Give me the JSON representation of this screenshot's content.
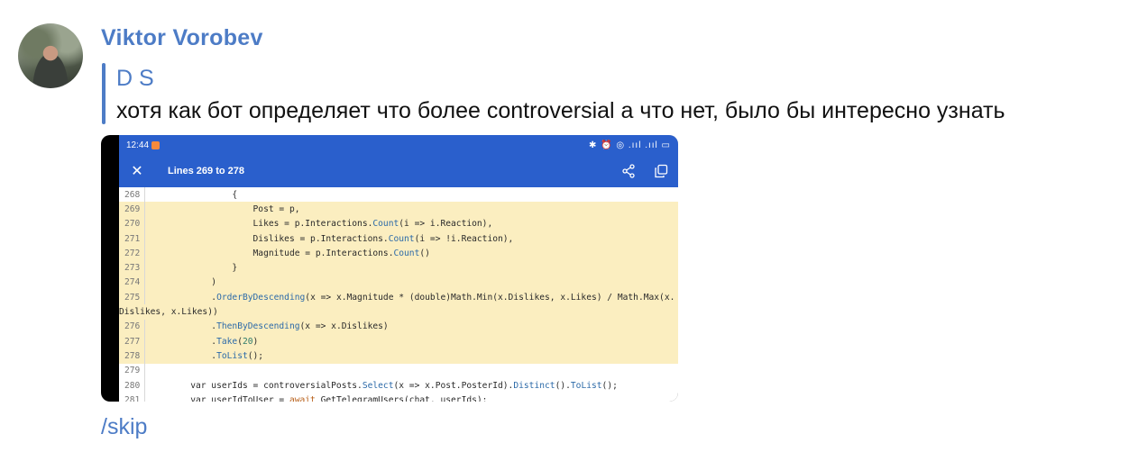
{
  "message": {
    "sender": "Viktor Vorobev",
    "reply": {
      "name": "D S",
      "text": "хотя как бот определяет что более controversial а что нет, было бы интересно узнать"
    },
    "command": "/skip"
  },
  "screenshot": {
    "statusbar": {
      "time": "12:44",
      "icons": "✱ ⏰ ◎ .ııl .ııl ▭"
    },
    "toolbar": {
      "title": "Lines 269 to 278",
      "close": "✕"
    },
    "lines": [
      {
        "n": "268",
        "hl": false,
        "code": "                {"
      },
      {
        "n": "269",
        "hl": true,
        "code": "                    Post = p,"
      },
      {
        "n": "270",
        "hl": true,
        "code": "                    Likes = p.Interactions.Count(i => i.Reaction),"
      },
      {
        "n": "271",
        "hl": true,
        "code": "                    Dislikes = p.Interactions.Count(i => !i.Reaction),"
      },
      {
        "n": "272",
        "hl": true,
        "code": "                    Magnitude = p.Interactions.Count()"
      },
      {
        "n": "273",
        "hl": true,
        "code": "                }"
      },
      {
        "n": "274",
        "hl": true,
        "code": "            )"
      },
      {
        "n": "275",
        "hl": true,
        "code": "            .OrderByDescending(x => x.Magnitude * (double)Math.Min(x.Dislikes, x.Likes) / Math.Max(x."
      },
      {
        "n": "",
        "hl": true,
        "code": "Dislikes, x.Likes))"
      },
      {
        "n": "276",
        "hl": true,
        "code": "            .ThenByDescending(x => x.Dislikes)"
      },
      {
        "n": "277",
        "hl": true,
        "code": "            .Take(20)"
      },
      {
        "n": "278",
        "hl": true,
        "code": "            .ToList();"
      },
      {
        "n": "279",
        "hl": false,
        "code": ""
      },
      {
        "n": "280",
        "hl": false,
        "code": "        var userIds = controversialPosts.Select(x => x.Post.PosterId).Distinct().ToList();"
      },
      {
        "n": "281",
        "hl": false,
        "code": "        var userIdToUser = await GetTelegramUsers(chat, userIds);"
      }
    ]
  },
  "colors": {
    "accent": "#4d7cc6",
    "appbar": "#2a5fcc",
    "highlight": "#fbeec0"
  }
}
